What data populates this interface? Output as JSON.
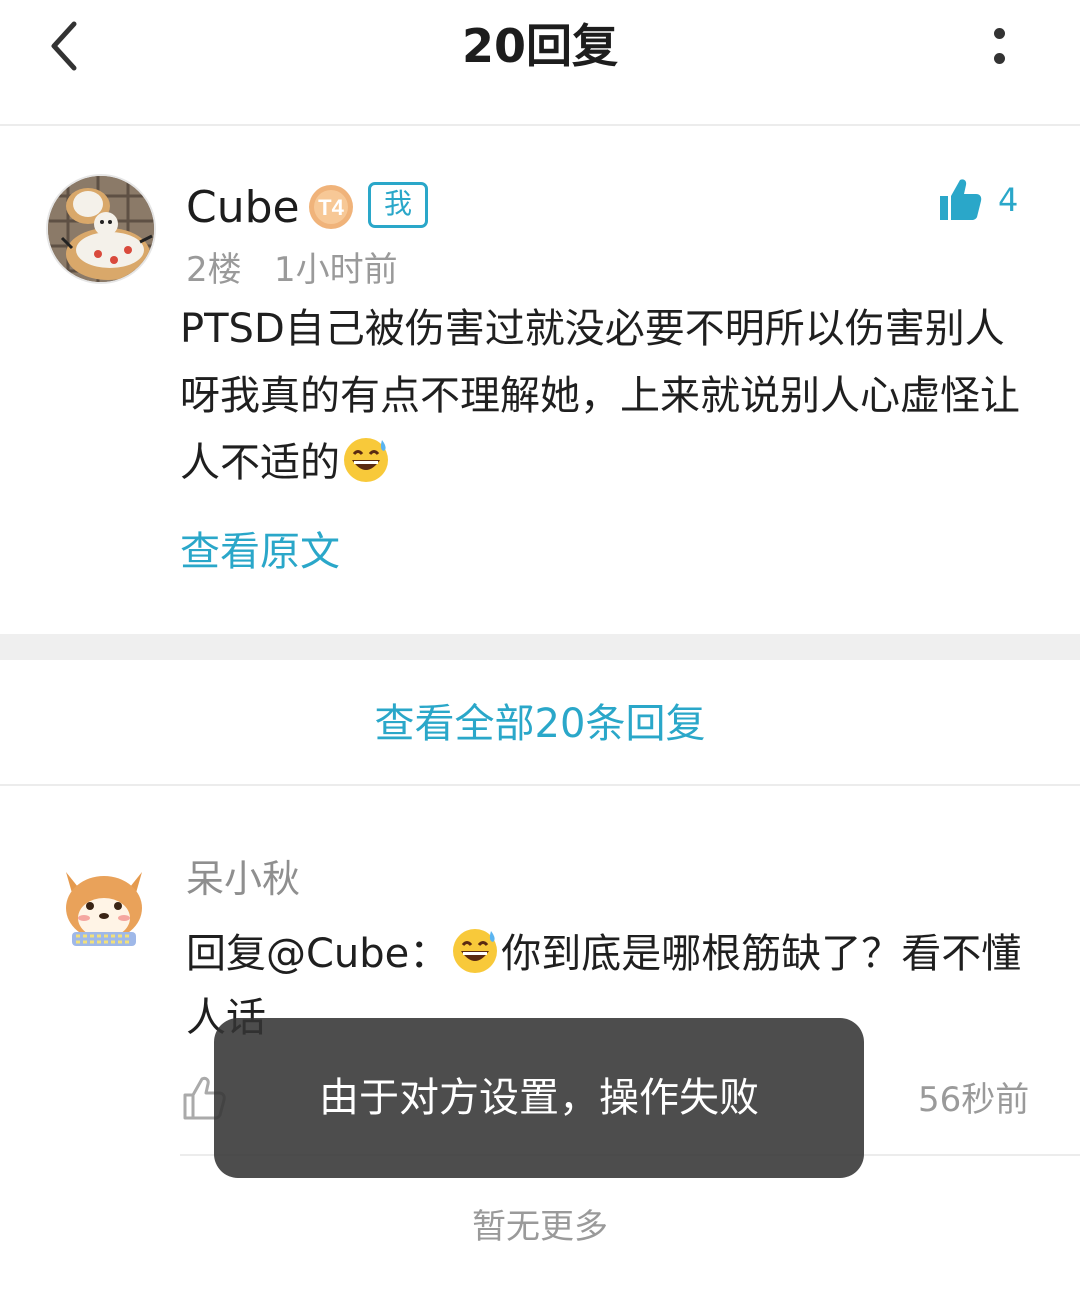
{
  "header": {
    "title": "20回复",
    "back_icon": "chevron-left-icon",
    "more_icon": "more-vertical-icon"
  },
  "post": {
    "user_name": "Cube",
    "level_badge": "T4",
    "me_tag": "我",
    "meta": "2楼   1小时前",
    "like_count": "4",
    "body_text": "PTSD自己被伤害过就没必要不明所以伤害别人呀我真的有点不理解她，上来就说别人心虚怪让人不适的",
    "body_emoji": "grinning-sweat-emoji",
    "view_original": "查看原文"
  },
  "all_replies_link": "查看全部20条回复",
  "reply": {
    "user_name": "呆小秋",
    "prefix": "回复@Cube：",
    "emoji": "grinning-sweat-emoji",
    "text": "你到底是哪根筋缺了？看不懂人话",
    "time": "56秒前"
  },
  "footer": {
    "no_more": "暂无更多"
  },
  "toast": {
    "message": "由于对方设置，操作失败"
  },
  "colors": {
    "accent": "#2aa7c9",
    "muted_text": "#9a9a9a",
    "toast_bg": "#343434",
    "divider": "#ececec"
  }
}
